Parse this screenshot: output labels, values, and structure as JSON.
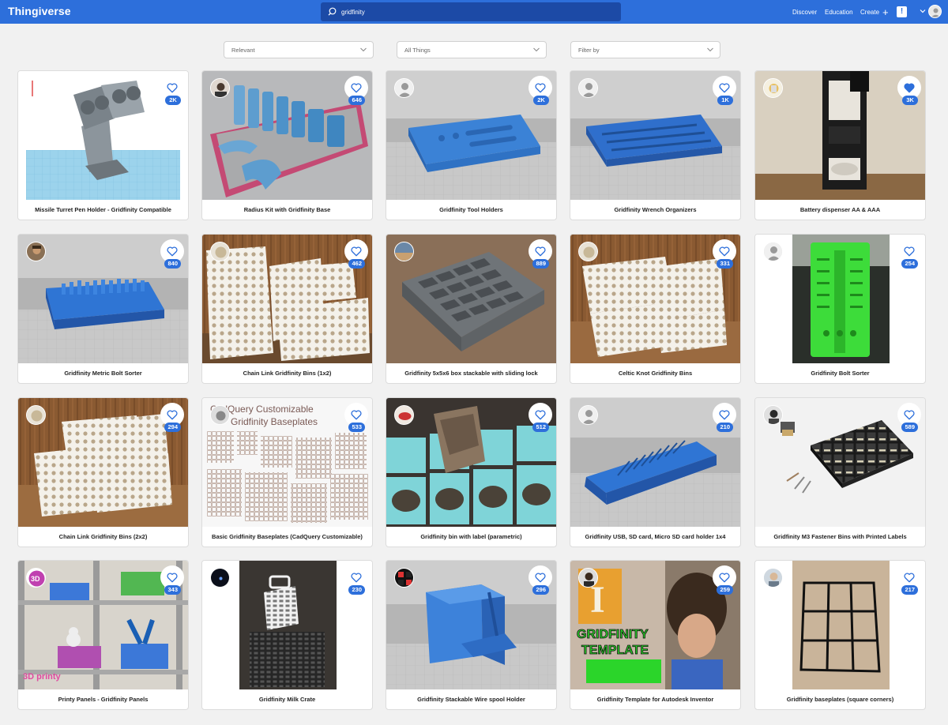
{
  "header": {
    "logo": "Thingiverse",
    "search_value": "gridfinity",
    "nav_discover": "Discover",
    "nav_education": "Education",
    "nav_create": "Create",
    "alert_label": "!"
  },
  "filters": {
    "sort": "Relevant",
    "type": "All Things",
    "filter": "Filter by"
  },
  "colors": {
    "brand": "#2d6fdb",
    "search_bg": "#1c4aa6",
    "page_bg": "#f1f1f1"
  },
  "cards": [
    {
      "title": "Missile Turret Pen Holder - Gridfinity Compatible",
      "likes": "2K",
      "liked": false,
      "icon": "missile-turret-render"
    },
    {
      "title": "Radius Kit with Gridfinity Base",
      "likes": "646",
      "liked": false,
      "icon": "radius-kit-photo"
    },
    {
      "title": "Gridfinity Tool Holders",
      "likes": "2K",
      "liked": false,
      "icon": "blue-tray-render"
    },
    {
      "title": "Gridfinity Wrench Organizers",
      "likes": "1K",
      "liked": false,
      "icon": "blue-wrench-tray-render"
    },
    {
      "title": "Battery dispenser AA & AAA",
      "likes": "3K",
      "liked": true,
      "icon": "battery-dispenser-photo"
    },
    {
      "title": "Gridfinity Metric Bolt Sorter",
      "likes": "840",
      "liked": false,
      "icon": "blue-bolt-sorter-render"
    },
    {
      "title": "Chain Link Gridfinity Bins (1x2)",
      "likes": "462",
      "liked": false,
      "icon": "white-lattice-bins-photo"
    },
    {
      "title": "Gridfinity 5x5x6 box stackable with sliding lock",
      "likes": "889",
      "liked": false,
      "icon": "grey-box-photo"
    },
    {
      "title": "Celtic Knot Gridfinity Bins",
      "likes": "331",
      "liked": false,
      "icon": "celtic-bins-photo"
    },
    {
      "title": "Gridfinity Bolt Sorter",
      "likes": "254",
      "liked": false,
      "icon": "green-bolt-sorter-photo"
    },
    {
      "title": "Chain Link Gridfinity Bins (2x2)",
      "likes": "294",
      "liked": false,
      "icon": "white-lattice-2x2-photo"
    },
    {
      "title": "Basic Gridfinity Baseplates (CadQuery Customizable)",
      "likes": "533",
      "liked": false,
      "icon": "baseplates-diagram"
    },
    {
      "title": "Gridfinity bin with label (parametric)",
      "likes": "512",
      "liked": false,
      "icon": "teal-bins-photo"
    },
    {
      "title": "Gridfinity USB, SD card, Micro SD card holder 1x4",
      "likes": "210",
      "liked": false,
      "icon": "blue-usb-holder-render"
    },
    {
      "title": "Gridfinity M3 Fastener Bins with Printed Labels",
      "likes": "589",
      "liked": false,
      "icon": "fastener-bins-photo"
    },
    {
      "title": "Printy Panels - Gridfinity Panels",
      "likes": "343",
      "liked": false,
      "icon": "shelf-panels-photo"
    },
    {
      "title": "Gridfinity Milk Crate",
      "likes": "230",
      "liked": false,
      "icon": "milk-crate-photo"
    },
    {
      "title": "Gridfinity Stackable Wire spool Holder",
      "likes": "296",
      "liked": false,
      "icon": "blue-spool-holder-render"
    },
    {
      "title": "Gridfinity Template for Autodesk Inventor",
      "likes": "259",
      "liked": false,
      "icon": "inventor-template-thumbnail"
    },
    {
      "title": "Gridfinity baseplates (square corners)",
      "likes": "217",
      "liked": false,
      "icon": "black-baseplate-photo"
    }
  ],
  "thumbnail_text": {
    "cadquery_line1": "CadQuery Customizable",
    "cadquery_line2": "Gridfinity Baseplates",
    "template_line1": "GRIDFINITY",
    "template_line2": "TEMPLATE",
    "printy_logo": "3D printy"
  }
}
